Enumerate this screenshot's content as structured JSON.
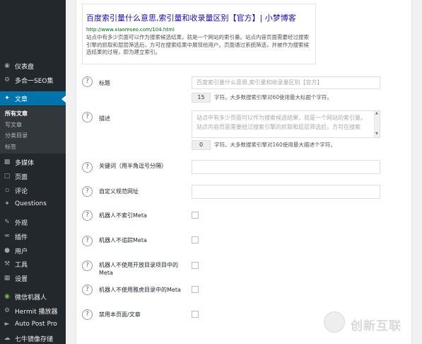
{
  "sidebar": {
    "items": [
      {
        "label": "仪表盘",
        "icon": "dashboard-icon"
      },
      {
        "label": "多合一SEO集",
        "icon": "gear-icon"
      },
      {
        "label": "文章",
        "icon": "pin-icon",
        "active": true
      },
      {
        "label": "多媒体",
        "icon": "media-icon"
      },
      {
        "label": "页面",
        "icon": "page-icon"
      },
      {
        "label": "评论",
        "icon": "comment-icon"
      },
      {
        "label": "Questions",
        "icon": "pin-icon"
      },
      {
        "label": "外观",
        "icon": "brush-icon"
      },
      {
        "label": "插件",
        "icon": "plugin-icon"
      },
      {
        "label": "用户",
        "icon": "user-icon"
      },
      {
        "label": "工具",
        "icon": "wrench-icon"
      },
      {
        "label": "设置",
        "icon": "settings-icon"
      },
      {
        "label": "微信机器人",
        "icon": "wechat-icon"
      },
      {
        "label": "Hermit 播放器",
        "icon": "gear-icon"
      },
      {
        "label": "Auto Post Pro",
        "icon": "play-icon"
      },
      {
        "label": "七牛镜像存储",
        "icon": "cloud-icon"
      }
    ],
    "submenu": [
      "所有文章",
      "写文章",
      "分类目录",
      "标签"
    ]
  },
  "preview": {
    "title": "百度索引量什么意思,索引量和收录量区别【官方】| 小梦博客",
    "url": "http://www.xiaomseo.com/104.html",
    "description": "站点中有多少页面可以作为搜索候选结果，就是一个网站的索引量。站点内容页面需要经过搜索引擎的抓取和层层筛选后，方可在搜索结果中展现给用户。页面通过系统筛选，并被作为搜索候选结果的过程，即为建立索引。"
  },
  "fields": {
    "title": {
      "label": "标题",
      "value": "百度索引量什么意思,索引量和收录量区别【官方】",
      "count": "15",
      "count_text": "字符。大多数搜索引擎对60使用最大标题个字符。"
    },
    "description": {
      "label": "描述",
      "value": "站点中有多少页面可以作为搜索候选结果，就是一个网站的索引量。站点内容页面需要经过搜索引擎的抓取和层层筛选后，方可在搜索",
      "count": "0",
      "count_text": "字符。大多数搜索引擎对160使用最大描述个字符。"
    },
    "keywords": {
      "label": "关键词（用半角逗号分隔）",
      "value": ""
    },
    "custom_canonical": {
      "label": "自定义规范网址",
      "value": ""
    },
    "noindex": {
      "label": "机器人不索引Meta",
      "checked": false
    },
    "nofollow": {
      "label": "机器人不追踪Meta",
      "checked": false
    },
    "noodp": {
      "label": "机器人不使用开放目录项目中的Meta",
      "checked": false
    },
    "noydir": {
      "label": "机器人不使用雅虎目录中的Meta",
      "checked": false
    },
    "disable": {
      "label": "禁用本页面/文章",
      "checked": false
    }
  },
  "watermark": {
    "text": "创新互联"
  },
  "colors": {
    "sidebar": "#23282d",
    "active": "#0073aa",
    "link": "#1a0dab",
    "url": "#006621"
  }
}
